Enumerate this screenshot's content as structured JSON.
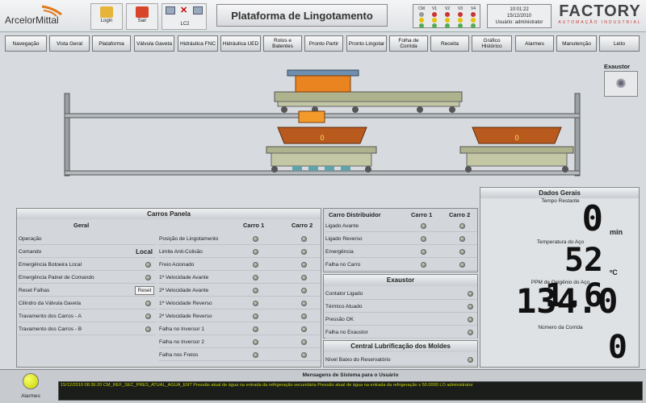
{
  "header": {
    "brand_left": "ArcelorMittal",
    "login_label": "Login",
    "sair_label": "Sair",
    "lc2_label": "LC2",
    "title": "Plataforma de Lingotamento",
    "traffic": [
      "CM",
      "V1",
      "V2",
      "V3",
      "V4"
    ],
    "time": "10:01:22",
    "date": "15/12/2010",
    "user": "Usuário: administrator",
    "brand_right": "FACTORY",
    "brand_right_sub": "AUTOMAÇÃO INDUSTRIAL"
  },
  "nav": [
    {
      "label": "Navegação"
    },
    {
      "label": "Vista Geral"
    },
    {
      "label": "Plataforma"
    },
    {
      "label": "Válvula Gaveta"
    },
    {
      "label": "Hidráulica FNC"
    },
    {
      "label": "Hidráulica UED"
    },
    {
      "label": "Rolos e Batentes"
    },
    {
      "label": "Pronto Partir"
    },
    {
      "label": "Pronto Lingotar"
    },
    {
      "label": "Folha de Corrida"
    },
    {
      "label": "Receita"
    },
    {
      "label": "Gráfico Histórico"
    },
    {
      "label": "Alarmes"
    },
    {
      "label": "Manutenção"
    },
    {
      "label": "Leito"
    }
  ],
  "scene": {
    "exaustor_label": "Exaustor",
    "ladle1_label": "0",
    "ladle2_label": "0"
  },
  "carros": {
    "title": "Carros Panela",
    "geral_title": "Geral",
    "col1": "Carro 1",
    "col2": "Carro 2",
    "geral": [
      {
        "label": "Operação"
      },
      {
        "label": "Comando",
        "value": "Local"
      },
      {
        "label": "Emergência Botoeira Local"
      },
      {
        "label": "Emergência Painel de Comando"
      },
      {
        "label": "Reset Falhas",
        "button": "Reset"
      },
      {
        "label": "Cilindro da Válvula Gaveta"
      },
      {
        "label": "Travamento dos Carros - A"
      },
      {
        "label": "Travamento dos Carros - B"
      }
    ],
    "status": [
      "Posição de Lingotamento",
      "Limite Anti-Colisão",
      "Freio Acionado",
      "1ª Velocidade Avante",
      "2ª Velocidade Avante",
      "1ª Velocidade Reverso",
      "2ª Velocidade Reverso",
      "Falha no Inversor 1",
      "Falha no Inversor 2",
      "Falha nos Freios"
    ]
  },
  "distribuidor": {
    "title": "Carro Distribuidor",
    "col1": "Carro 1",
    "col2": "Carro 2",
    "rows": [
      "Ligado Avante",
      "Ligado Reverso",
      "Emergência",
      "Falha no Carro"
    ]
  },
  "exaustor": {
    "title": "Exaustor",
    "rows": [
      "Contator Ligado",
      "Térmico Atuado",
      "Pressão OK",
      "Falha no Exaustor"
    ]
  },
  "lubrificacao": {
    "title": "Central Lubrificação dos Moldes",
    "rows": [
      "Nível Baixo do Reservatório"
    ]
  },
  "dados": {
    "title": "Dados Gerais",
    "tempo_label": "Tempo Restante",
    "tempo_value": "0",
    "tempo_unit": "min",
    "temp_label": "Temperatura do Aço",
    "temp_value": "52 1.6",
    "temp_unit": "ºC",
    "ppm_label": "PPM de Oxigênio do Aço",
    "ppm_value": "134.0",
    "corrida_label": "Número da Corrida",
    "corrida_value": "0"
  },
  "footer": {
    "alarmes_label": "Alarmes",
    "msg_title": "Mensagens de Sistema para o Usuário",
    "msg_line": "15/12/2010 08:36:20   CM_REF_SEC_PRES_ATUAL_AGUA_ENT      Pressão atual de água na entrada da refrigeração secundária            Pressão atual de água na entrada da refrigeração s           50.0000          LO           administrator"
  },
  "colors": {
    "led_off": "#8a9186",
    "ladle": "#b85a1e",
    "cart": "#aeb38e",
    "status_green": "#d8e000"
  }
}
